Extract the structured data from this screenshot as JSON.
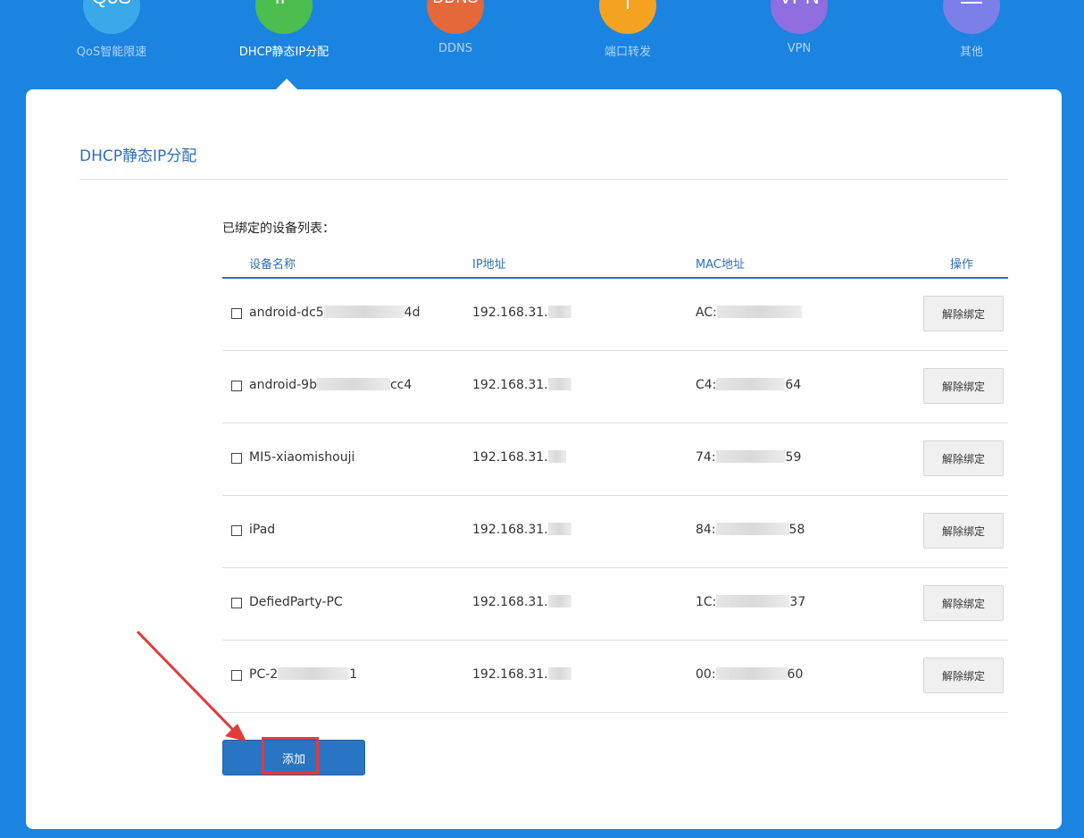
{
  "nav": {
    "items": [
      {
        "icon_text": "QoS",
        "label": "QoS智能限速",
        "color": "#3aa9e9",
        "active": false
      },
      {
        "icon_text": "IP",
        "label": "DHCP静态IP分配",
        "color": "#4cbd4f",
        "active": true
      },
      {
        "icon_text": "DDNS",
        "label": "DDNS",
        "color": "#e4683a",
        "active": false
      },
      {
        "icon_text": "",
        "label": "端口转发",
        "color": "#f4a321",
        "active": false
      },
      {
        "icon_text": "VPN",
        "label": "VPN",
        "color": "#8f6ee0",
        "active": false
      },
      {
        "icon_text": "",
        "label": "其他",
        "color": "#7d7fe8",
        "active": false
      }
    ]
  },
  "panel": {
    "title": "DHCP静态IP分配",
    "list_caption": "已绑定的设备列表：",
    "columns": {
      "name": "设备名称",
      "ip": "IP地址",
      "mac": "MAC地址",
      "action": "操作"
    },
    "rows": [
      {
        "name_a": "android-dc5",
        "name_b": "4d",
        "ip": "192.168.31.",
        "mac_a": "AC:",
        "mac_b": ""
      },
      {
        "name_a": "android-9b",
        "name_b": "cc4",
        "ip": "192.168.31.",
        "mac_a": "C4:",
        "mac_b": "64"
      },
      {
        "name_a": "MI5-xiaomishouji",
        "name_b": "",
        "ip": "192.168.31.",
        "mac_a": "74:",
        "mac_b": "59"
      },
      {
        "name_a": "iPad",
        "name_b": "",
        "ip": "192.168.31.",
        "mac_a": "84:",
        "mac_b": "58"
      },
      {
        "name_a": "DefiedParty-PC",
        "name_b": "",
        "ip": "192.168.31.",
        "mac_a": "1C:",
        "mac_b": "37"
      },
      {
        "name_a": "PC-2",
        "name_b": "1",
        "ip": "192.168.31.",
        "mac_a": "00:",
        "mac_b": "60"
      }
    ],
    "unbind_label": "解除绑定",
    "add_label": "添加"
  },
  "colors": {
    "background": "#1b83e0",
    "accent": "#2e6fb8",
    "annotation": "#e23b3b"
  }
}
